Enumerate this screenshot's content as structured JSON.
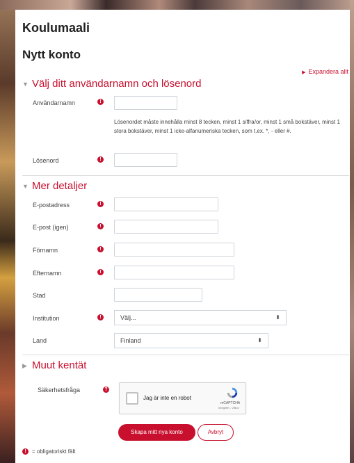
{
  "site": {
    "title": "Koulumaali"
  },
  "page": {
    "title": "Nytt konto",
    "expand_all": "Expandera allt"
  },
  "sections": {
    "credentials": {
      "title": "Välj ditt användarnamn och lösenord"
    },
    "details": {
      "title": "Mer detaljer"
    },
    "other": {
      "title": "Muut kentät"
    }
  },
  "fields": {
    "username": {
      "label": "Användarnamn",
      "value": ""
    },
    "password_policy": "Lösenordet måste innehålla minst 8 tecken, minst 1 siffra/or, minst 1 små bokstäver, minst 1 stora bokstäver, minst 1 icke-alfanumeriska tecken, som t.ex. *, - eller #.",
    "password": {
      "label": "Lösenord",
      "value": ""
    },
    "email": {
      "label": "E-postadress",
      "value": ""
    },
    "email2": {
      "label": "E-post (igen)",
      "value": ""
    },
    "firstname": {
      "label": "Förnamn",
      "value": ""
    },
    "lastname": {
      "label": "Efternamn",
      "value": ""
    },
    "city": {
      "label": "Stad",
      "value": ""
    },
    "institution": {
      "label": "Institution",
      "selected": "Välj..."
    },
    "country": {
      "label": "Land",
      "selected": "Finland"
    }
  },
  "captcha": {
    "label": "Säkerhetsfråga",
    "checkbox_text": "Jag är inte en robot",
    "brand": "reCAPTCHA",
    "terms": "Integritet - Villkor"
  },
  "buttons": {
    "submit": "Skapa mitt nya konto",
    "cancel": "Avbryt"
  },
  "legend": {
    "text": "= obligatoriskt fält"
  },
  "icons": {
    "required": "!",
    "help": "?"
  },
  "colors": {
    "accent": "#c8102e",
    "text": "#333333"
  }
}
